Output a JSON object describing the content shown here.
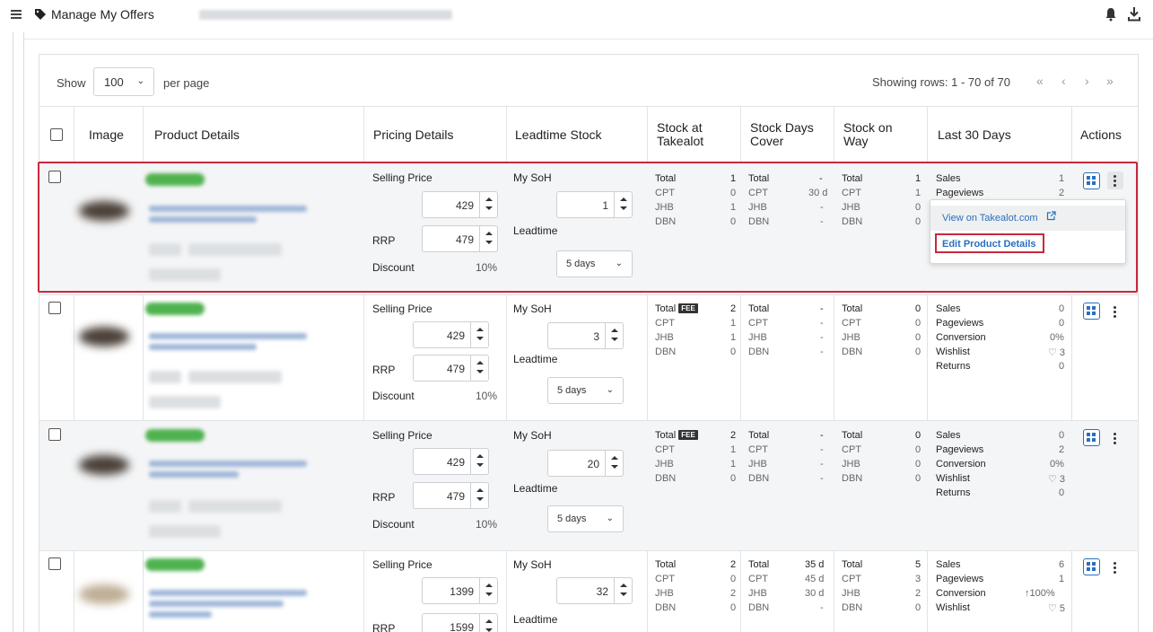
{
  "header": {
    "title": "Manage My Offers",
    "icons": [
      "menu-icon",
      "tag-icon",
      "bell-icon",
      "download-icon"
    ]
  },
  "toolbar": {
    "show_label": "Show",
    "per_page_value": "100",
    "per_page_label": "per page",
    "rows_info": "Showing rows: 1 - 70 of 70",
    "pager": {
      "first": "«",
      "prev": "‹",
      "next": "›",
      "last": "»"
    }
  },
  "columns": {
    "image": "Image",
    "product_details": "Product Details",
    "pricing_details": "Pricing Details",
    "leadtime_stock": "Leadtime Stock",
    "stock_at_takealot_1": "Stock at",
    "stock_at_takealot_2": "Takealot",
    "stock_days_cover_1": "Stock Days",
    "stock_days_cover_2": "Cover",
    "stock_on_way_1": "Stock on",
    "stock_on_way_2": "Way",
    "last_30_days": "Last 30 Days",
    "actions": "Actions"
  },
  "labels": {
    "selling_price": "Selling Price",
    "rrp": "RRP",
    "discount": "Discount",
    "my_soh": "My SoH",
    "leadtime": "Leadtime",
    "total": "Total",
    "fee": "FEE",
    "cpt": "CPT",
    "jhb": "JHB",
    "dbn": "DBN",
    "sales": "Sales",
    "pageviews": "Pageviews",
    "conversion": "Conversion",
    "wishlist": "Wishlist",
    "returns": "Returns"
  },
  "rows": [
    {
      "selling_price": "429",
      "rrp": "479",
      "discount": "10%",
      "soh": "1",
      "leadtime": "5 days",
      "takealot": {
        "total": "1",
        "cpt": "0",
        "jhb": "1",
        "dbn": "0"
      },
      "cover": {
        "total": "-",
        "cpt": "30 d",
        "jhb": "-",
        "dbn": "-"
      },
      "onway": {
        "total": "1",
        "cpt": "1",
        "jhb": "0",
        "dbn": "0"
      },
      "last30": {
        "sales": "1",
        "pageviews": "2"
      }
    },
    {
      "selling_price": "429",
      "rrp": "479",
      "discount": "10%",
      "soh": "3",
      "leadtime": "5 days",
      "takealot": {
        "total": "2",
        "cpt": "1",
        "jhb": "1",
        "dbn": "0"
      },
      "cover": {
        "total": "-",
        "cpt": "-",
        "jhb": "-",
        "dbn": "-"
      },
      "onway": {
        "total": "0",
        "cpt": "0",
        "jhb": "0",
        "dbn": "0"
      },
      "last30": {
        "sales": "0",
        "pageviews": "0",
        "conversion": "0%",
        "wishlist": "♡ 3",
        "returns": "0"
      }
    },
    {
      "selling_price": "429",
      "rrp": "479",
      "discount": "10%",
      "soh": "20",
      "leadtime": "5 days",
      "takealot": {
        "total": "2",
        "cpt": "1",
        "jhb": "1",
        "dbn": "0"
      },
      "cover": {
        "total": "-",
        "cpt": "-",
        "jhb": "-",
        "dbn": "-"
      },
      "onway": {
        "total": "0",
        "cpt": "0",
        "jhb": "0",
        "dbn": "0"
      },
      "last30": {
        "sales": "0",
        "pageviews": "2",
        "conversion": "0%",
        "wishlist": "♡ 3",
        "returns": "0"
      }
    },
    {
      "selling_price": "1399",
      "rrp": "1599",
      "soh": "32",
      "takealot": {
        "total": "2",
        "cpt": "0",
        "jhb": "2",
        "dbn": "0"
      },
      "cover": {
        "total": "35 d",
        "cpt": "45 d",
        "jhb": "30 d",
        "dbn": "-"
      },
      "onway": {
        "total": "5",
        "cpt": "3",
        "jhb": "2",
        "dbn": "0"
      },
      "last30": {
        "sales": "6",
        "pageviews": "1",
        "conversion": "↑100%",
        "wishlist": "♡ 5"
      }
    }
  ],
  "dropdown": {
    "view_on": "View on Takealot.com",
    "edit": "Edit Product Details"
  },
  "colors": {
    "accent_blue": "#2a6fbe",
    "highlight_red": "#c8283c",
    "green_badge": "#4fb24f"
  }
}
